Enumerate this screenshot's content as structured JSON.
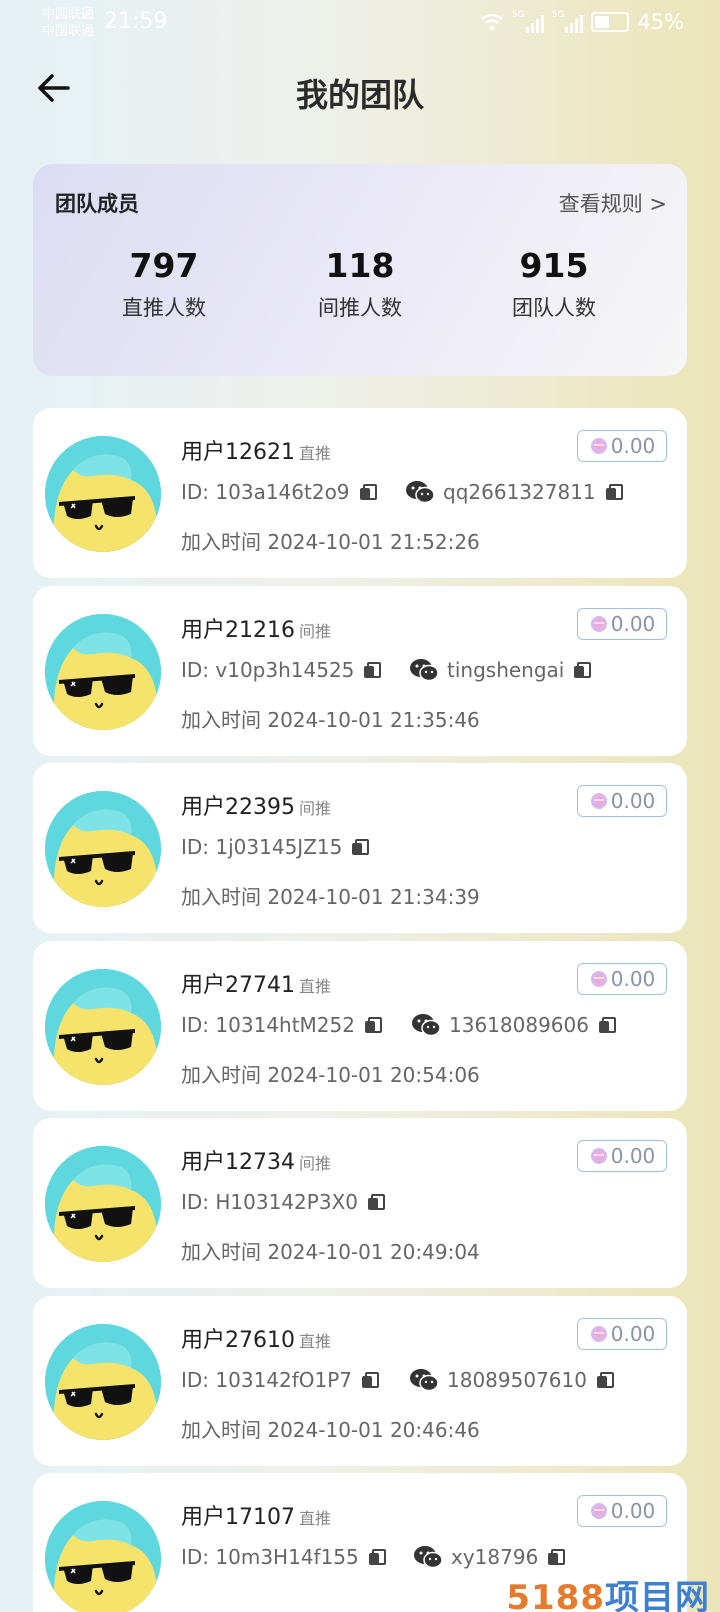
{
  "status_bar": {
    "carrier_1": "中国联通",
    "carrier_2": "中国联通",
    "time": "21:59",
    "network_1": "5G",
    "network_2": "5G",
    "battery": "45%"
  },
  "header": {
    "title": "我的团队"
  },
  "summary": {
    "label": "团队成员",
    "rules_link": "查看规则 >",
    "stats": [
      {
        "value": "797",
        "label": "直推人数"
      },
      {
        "value": "118",
        "label": "间推人数"
      },
      {
        "value": "915",
        "label": "团队人数"
      }
    ]
  },
  "members": [
    {
      "name": "用户12621",
      "type": "直推",
      "id": "ID: 103a146t2o9",
      "wechat": "qq2661327811",
      "join": "加入时间 2024-10-01 21:52:26",
      "balance": "0.00"
    },
    {
      "name": "用户21216",
      "type": "间推",
      "id": "ID: v10p3h14525",
      "wechat": "tingshengai",
      "join": "加入时间 2024-10-01 21:35:46",
      "balance": "0.00"
    },
    {
      "name": "用户22395",
      "type": "间推",
      "id": "ID: 1j03145JZ15",
      "wechat": "",
      "join": "加入时间 2024-10-01 21:34:39",
      "balance": "0.00"
    },
    {
      "name": "用户27741",
      "type": "直推",
      "id": "ID: 10314htM252",
      "wechat": "13618089606",
      "join": "加入时间 2024-10-01 20:54:06",
      "balance": "0.00"
    },
    {
      "name": "用户12734",
      "type": "间推",
      "id": "ID: H103142P3X0",
      "wechat": "",
      "join": "加入时间 2024-10-01 20:49:04",
      "balance": "0.00"
    },
    {
      "name": "用户27610",
      "type": "直推",
      "id": "ID: 103142fO1P7",
      "wechat": "18089507610",
      "join": "加入时间 2024-10-01 20:46:46",
      "balance": "0.00"
    },
    {
      "name": "用户17107",
      "type": "直推",
      "id": "ID: 10m3H14f155",
      "wechat": "xy18796",
      "join": "",
      "balance": "0.00"
    }
  ],
  "watermark": {
    "prefix": "5188",
    "suffix": "项目网"
  }
}
